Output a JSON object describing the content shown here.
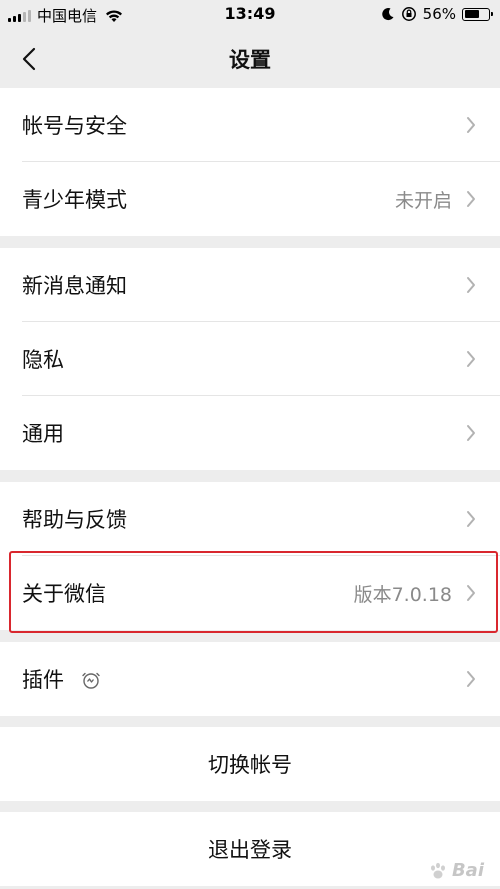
{
  "status_bar": {
    "carrier": "中国电信",
    "time": "13:49",
    "battery": "56%"
  },
  "nav": {
    "title": "设置",
    "back_icon": "chevron-left-icon"
  },
  "groups": [
    {
      "items": [
        {
          "label": "帐号与安全",
          "value": ""
        },
        {
          "label": "青少年模式",
          "value": "未开启"
        }
      ]
    },
    {
      "items": [
        {
          "label": "新消息通知",
          "value": ""
        },
        {
          "label": "隐私",
          "value": ""
        },
        {
          "label": "通用",
          "value": ""
        }
      ]
    },
    {
      "items": [
        {
          "label": "帮助与反馈",
          "value": ""
        },
        {
          "label": "关于微信",
          "value": "版本7.0.18"
        }
      ]
    },
    {
      "items": [
        {
          "label": "插件",
          "value": "",
          "icon": "plugin-clock-icon"
        }
      ]
    }
  ],
  "actions": {
    "switch_account": "切换帐号",
    "logout": "退出登录"
  },
  "colors": {
    "background": "#ededed",
    "cell": "#ffffff",
    "highlight": "#d9272e",
    "secondary_text": "#8a8a8a"
  }
}
